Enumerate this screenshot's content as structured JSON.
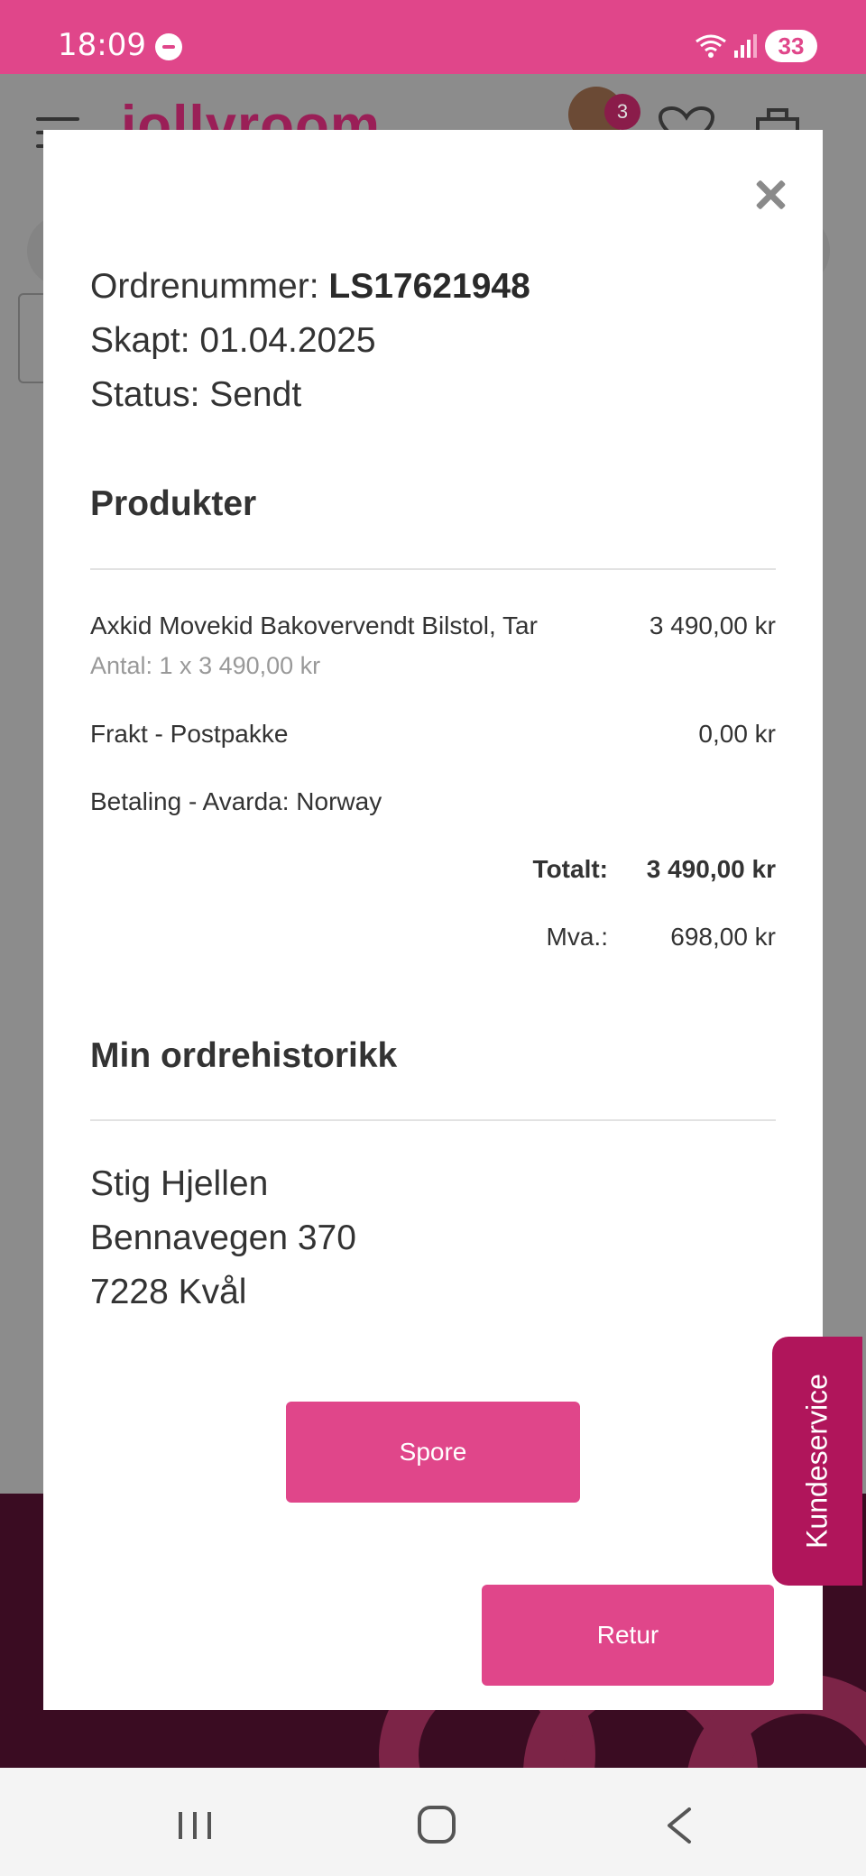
{
  "status_bar": {
    "time": "18:09",
    "battery": "33"
  },
  "background": {
    "logo_text": "jollyroom",
    "cart_badge": "3"
  },
  "order": {
    "number_label": "Ordrenummer: ",
    "number_value": "LS17621948",
    "created": "Skapt: 01.04.2025",
    "status": "Status: Sendt"
  },
  "products": {
    "title": "Produkter",
    "items": [
      {
        "name": "Axkid Movekid Bakovervendt Bilstol, Tar",
        "price": "3 490,00 kr",
        "quantity": "Antal: 1 x 3 490,00 kr"
      }
    ],
    "shipping_label": "Frakt - Postpakke",
    "shipping_price": "0,00 kr",
    "payment_label": "Betaling - Avarda: Norway",
    "total_label": "Totalt:",
    "total_value": "3 490,00 kr",
    "vat_label": "Mva.:",
    "vat_value": "698,00 kr"
  },
  "history": {
    "title": "Min ordrehistorikk",
    "name": "Stig Hjellen",
    "street": "Bennavegen 370",
    "city": "7228 Kvål"
  },
  "buttons": {
    "track": "Spore",
    "return": "Retur"
  },
  "customer_service": "Kundeservice",
  "colors": {
    "accent": "#e0468a",
    "customer_service": "#b0155b",
    "footer": "#3a0c22"
  }
}
